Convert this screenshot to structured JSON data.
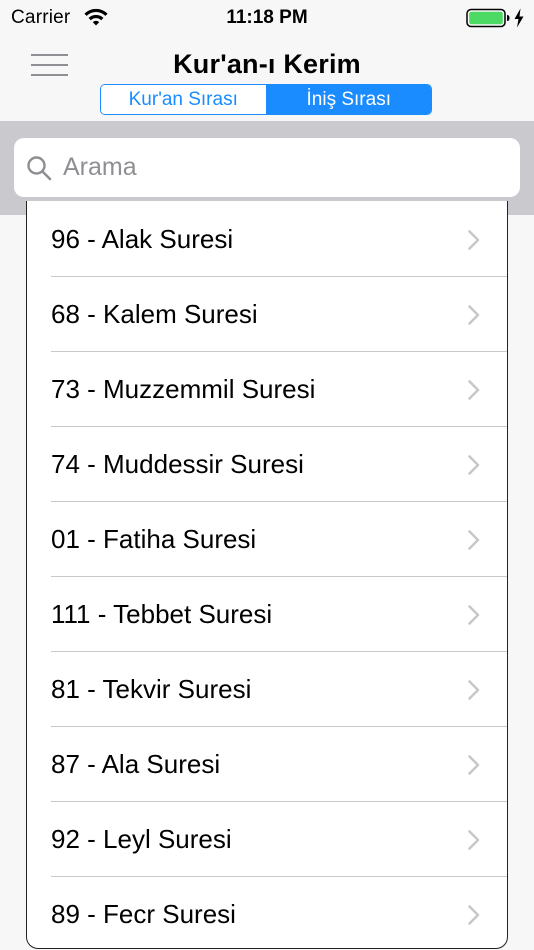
{
  "status_bar": {
    "carrier": "Carrier",
    "time": "11:18 PM",
    "wifi_icon": "wifi-icon",
    "battery_icon": "battery-icon",
    "battery_level": 1.0,
    "charge_icon": "charging-bolt-icon",
    "battery_color": "#4cd964"
  },
  "nav": {
    "menu_icon": "hamburger-menu-icon",
    "title": "Kur'an-ı Kerim",
    "segments": [
      {
        "label": "Kur'an Sırası",
        "selected": false
      },
      {
        "label": "İniş Sırası",
        "selected": true
      }
    ],
    "accent": "#1a8cff"
  },
  "search": {
    "icon": "search-icon",
    "placeholder": "Arama"
  },
  "list": {
    "chevron_icon": "chevron-right-icon",
    "items": [
      {
        "label": "96 - Alak Suresi"
      },
      {
        "label": "68 - Kalem Suresi"
      },
      {
        "label": "73 - Muzzemmil Suresi"
      },
      {
        "label": "74 - Muddessir Suresi"
      },
      {
        "label": "01 - Fatiha Suresi"
      },
      {
        "label": "111 - Tebbet Suresi"
      },
      {
        "label": "81 - Tekvir Suresi"
      },
      {
        "label": "87 - Ala Suresi"
      },
      {
        "label": "92 - Leyl Suresi"
      },
      {
        "label": "89 - Fecr Suresi"
      }
    ]
  }
}
